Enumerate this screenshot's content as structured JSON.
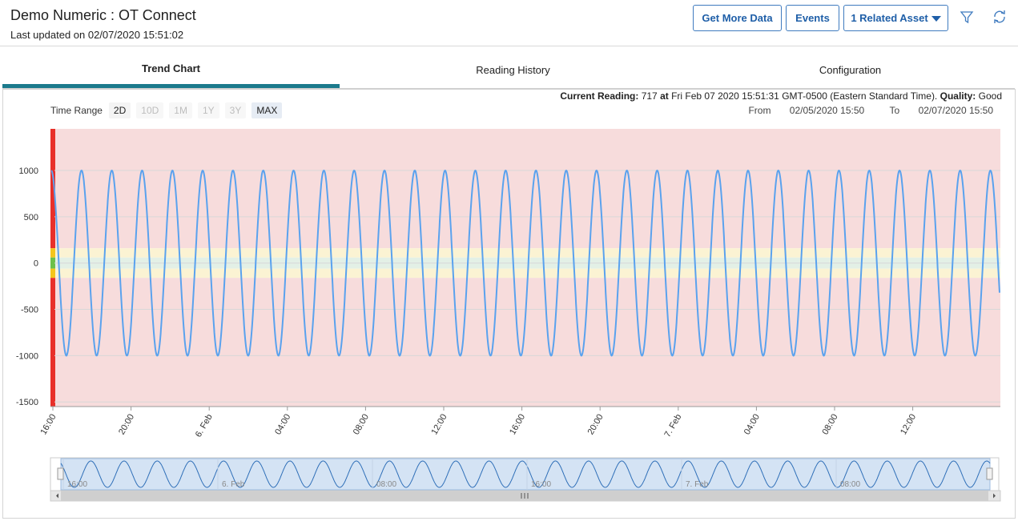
{
  "header": {
    "title": "Demo Numeric : OT Connect",
    "last_updated": "Last updated on 02/07/2020 15:51:02",
    "buttons": {
      "get_more_data": "Get More Data",
      "events": "Events",
      "related_asset": "1 Related Asset"
    },
    "icons": {
      "filter": "filter-icon",
      "refresh": "refresh-icon"
    }
  },
  "tabs": [
    {
      "label": "Trend Chart",
      "active": true
    },
    {
      "label": "Reading History",
      "active": false
    },
    {
      "label": "Configuration",
      "active": false
    }
  ],
  "time_range": {
    "label": "Time Range",
    "options": [
      {
        "label": "2D",
        "state": "enabled"
      },
      {
        "label": "10D",
        "state": "disabled"
      },
      {
        "label": "1M",
        "state": "disabled"
      },
      {
        "label": "1Y",
        "state": "disabled"
      },
      {
        "label": "3Y",
        "state": "disabled"
      },
      {
        "label": "MAX",
        "state": "selected"
      }
    ]
  },
  "current_reading": {
    "label": "Current Reading:",
    "value": "717",
    "at_label": "at",
    "timestamp": "Fri Feb 07 2020 15:51:31 GMT-0500 (Eastern Standard Time).",
    "quality_label": "Quality:",
    "quality": "Good"
  },
  "range": {
    "from_label": "From",
    "from": "02/05/2020 15:50",
    "to_label": "To",
    "to": "02/07/2020 15:50"
  },
  "colors": {
    "line": "#5aa2ee",
    "alarm_band": "#f7dcdc",
    "warning_band": "#fbf3d3",
    "normal_band": "#e3f0e6",
    "alarm_bar": "#e8302a",
    "warning_bar": "#f4c51b",
    "normal_bar": "#6cc04a",
    "tab_accent": "#1b7a8c"
  },
  "chart_data": {
    "type": "line",
    "series": [
      {
        "values_description": "sinusoid",
        "amplitude": 1000,
        "cycles": 31.3,
        "last_value": -320
      }
    ],
    "y_ticks": [
      "1000",
      "500",
      "0",
      "-500",
      "-1000",
      "-1500"
    ],
    "ylim": [
      -1550,
      1450
    ],
    "x_ticks": [
      "16:00",
      "20:00",
      "6. Feb",
      "04:00",
      "08:00",
      "12:00",
      "16:00",
      "20:00",
      "7. Feb",
      "04:00",
      "08:00",
      "12:00"
    ],
    "bands": [
      {
        "name": "alarm-high",
        "from": 160,
        "to": 1450
      },
      {
        "name": "warning-high",
        "from": 60,
        "to": 160
      },
      {
        "name": "normal",
        "from": -60,
        "to": 60
      },
      {
        "name": "warning-low",
        "from": -160,
        "to": -60
      },
      {
        "name": "alarm-low",
        "from": -1550,
        "to": -160
      }
    ],
    "navigator_ticks": [
      "16:00",
      "6. Feb",
      "08:00",
      "16:00",
      "7. Feb",
      "08:00"
    ]
  }
}
